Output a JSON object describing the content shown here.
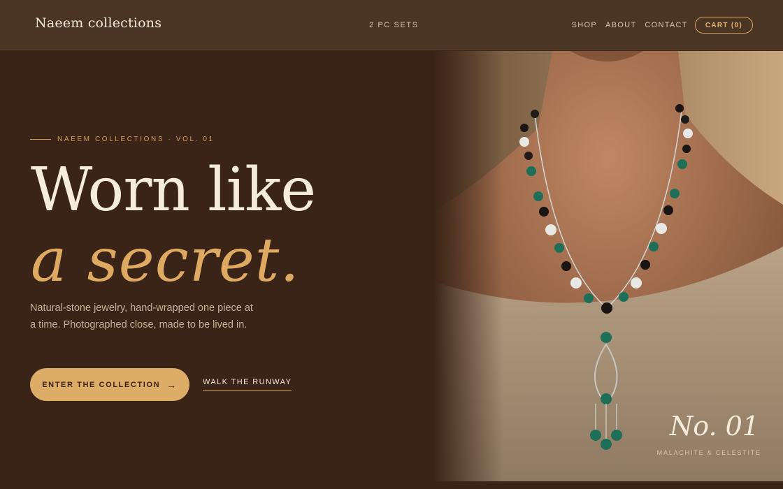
{
  "header": {
    "brand": "Naeem collections",
    "center_link": "2 PC SETS",
    "nav": [
      "SHOP",
      "ABOUT",
      "CONTACT"
    ],
    "cart": "CART (0)"
  },
  "hero": {
    "eyebrow": "NAEEM COLLECTIONS · VOL. 01",
    "headline_line1": "Worn like",
    "headline_line2": "a secret.",
    "description": "Natural-stone jewelry, hand-wrapped one piece at a time. Photographed close, made to be lived in.",
    "cta_label": "ENTER THE COLLECTION",
    "cta_icon": "arrow-right-icon",
    "secondary_label": "WALK THE RUNWAY"
  },
  "feature": {
    "number": "No. 01",
    "caption": "MALACHITE & CELESTITE"
  },
  "colors": {
    "background": "#3a2417",
    "header": "#4a3424",
    "accent_gold": "#ddac66",
    "cream": "#f6ecdc"
  }
}
